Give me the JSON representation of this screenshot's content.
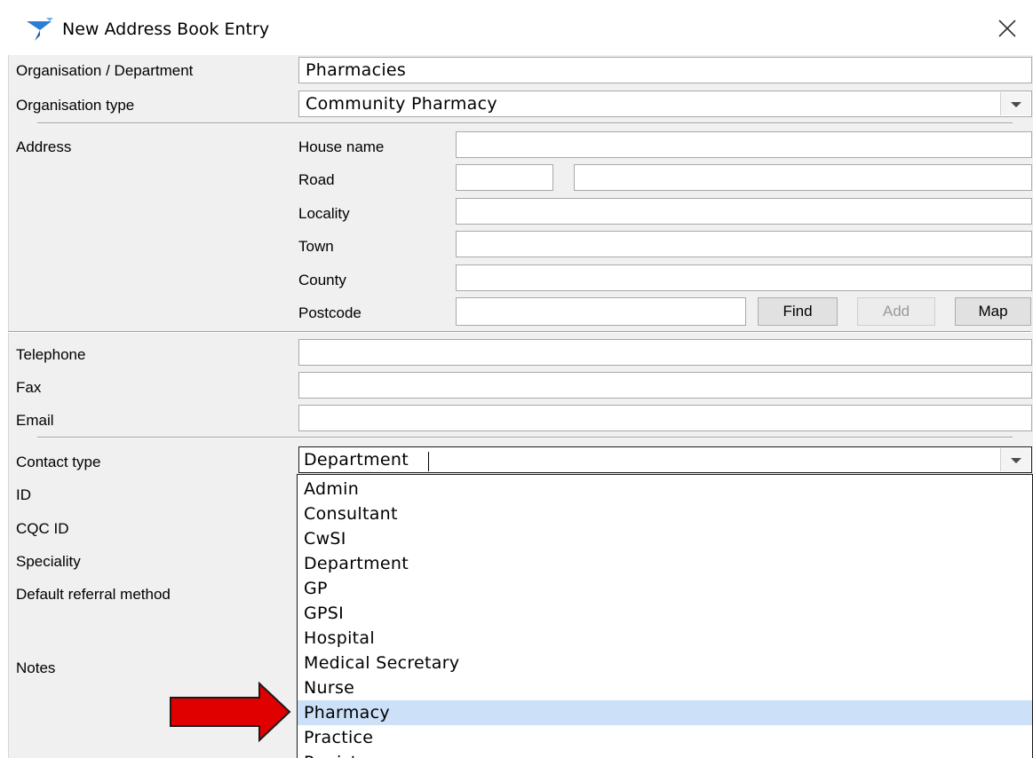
{
  "window": {
    "title": "New Address Book Entry"
  },
  "form": {
    "org_label": "Organisation / Department",
    "org_value": "Pharmacies",
    "org_type_label": "Organisation type",
    "org_type_value": "Community Pharmacy",
    "address_label": "Address",
    "house_name_label": "House name",
    "road_label": "Road",
    "locality_label": "Locality",
    "town_label": "Town",
    "county_label": "County",
    "postcode_label": "Postcode",
    "telephone_label": "Telephone",
    "fax_label": "Fax",
    "email_label": "Email",
    "contact_type_label": "Contact type",
    "contact_type_value": "Department",
    "id_label": "ID",
    "cqc_id_label": "CQC ID",
    "speciality_label": "Speciality",
    "referral_label": "Default referral method",
    "notes_label": "Notes"
  },
  "buttons": {
    "find": "Find",
    "add": "Add",
    "map": "Map"
  },
  "dropdown": {
    "items": [
      "Admin",
      "Consultant",
      "CwSI",
      "Department",
      "GP",
      "GPSI",
      "Hospital",
      "Medical Secretary",
      "Nurse",
      "Pharmacy",
      "Practice",
      "Registrar"
    ],
    "selected": "Pharmacy"
  },
  "colors": {
    "panel": "#f0f0f0",
    "selection": "#cce0f7",
    "arrow": "#e00000"
  },
  "icons": {
    "app": "address-book-app-icon",
    "close": "close-icon",
    "arrow": "red-arrow-annotation"
  }
}
